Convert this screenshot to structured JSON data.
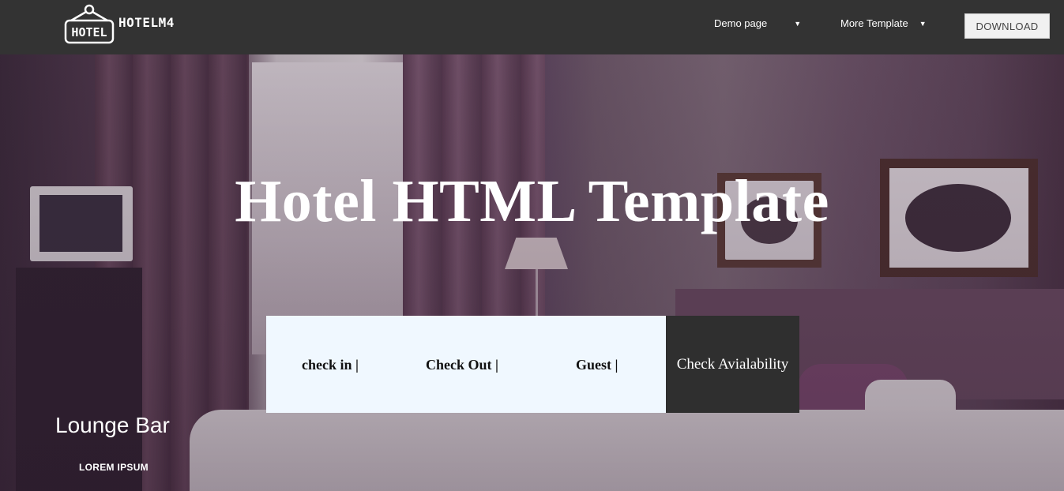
{
  "brand": {
    "badge_text": "HOTEL",
    "name": "HOTELM4"
  },
  "nav": {
    "items": [
      {
        "label": "Demo page",
        "icon": "caret-down-icon"
      },
      {
        "label": "More Template",
        "icon": "caret-down-icon"
      }
    ],
    "download_label": "DOWNLOAD"
  },
  "hero": {
    "title": "Hotel HTML Template"
  },
  "booking": {
    "check_in_label": "check in |",
    "check_out_label": "Check Out |",
    "guest_label": "Guest |",
    "availability_label": "Check Avialability"
  },
  "section": {
    "title": "Lounge Bar",
    "subtitle": "LOREM IPSUM"
  },
  "colors": {
    "navbar": "#333333",
    "booking_bg": "#f0f8ff",
    "availability_bg": "#2f2f2f",
    "text_light": "#ffffff"
  }
}
